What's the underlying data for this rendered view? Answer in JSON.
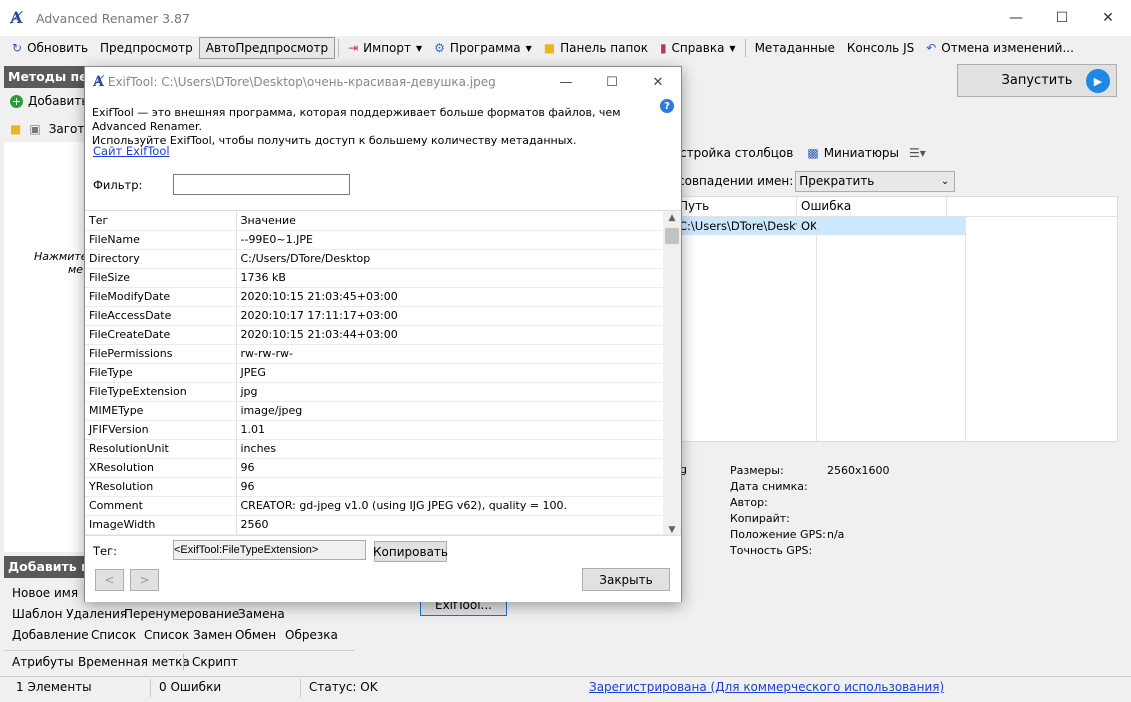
{
  "app": {
    "title": "Advanced Renamer 3.87",
    "icon": "app-logo-icon"
  },
  "window_controls": {
    "minimize": "—",
    "maximize": "☐",
    "close": "✕"
  },
  "toolbar": {
    "refresh": "Обновить",
    "preview": "Предпросмотр",
    "autopreview": "АвтоПредпросмотр",
    "import": "Импорт",
    "program": "Программа",
    "folder_panel": "Панель папок",
    "help": "Справка",
    "metadata": "Метаданные",
    "js_console": "Консоль JS",
    "undo": "Отмена изменений..."
  },
  "run_button": "Запустить",
  "left_panel": {
    "header": "Методы пе",
    "add": "Добавить",
    "templates": "Загот",
    "hint_line1": "Нажмите к",
    "hint_line2": "мет"
  },
  "right_panel": {
    "column_setup": "стройка столбцов",
    "thumbnails": "Миниатюры",
    "name_conflict_label": "совпадении имен:",
    "name_conflict_value": "Прекратить",
    "columns": [
      "Путь",
      "Ошибка"
    ],
    "rows": [
      [
        "C:\\Users\\DTore\\Desktop\\",
        "OK"
      ]
    ],
    "partial_text": "g"
  },
  "info_panel": {
    "labels": [
      "Размеры:",
      "Дата снимка:",
      "Автор:",
      "Копирайт:",
      "Положение GPS:",
      "Точность GPS:"
    ],
    "values": [
      "2560x1600",
      "",
      "",
      "",
      "n/a",
      ""
    ],
    "exiftool_button": "ExifTool..."
  },
  "add_methods": {
    "header": "Добавить м",
    "row1": [
      "Новое имя"
    ],
    "row2": [
      "Шаблон Удаления",
      "Перенумерование",
      "Замена"
    ],
    "row3": [
      "Добавление",
      "Список",
      "Список Замен",
      "Обмен",
      "Обрезка"
    ],
    "row4": [
      "Атрибуты",
      "Временная метка",
      "Скрипт"
    ]
  },
  "status_bar": {
    "items": "1 Элементы",
    "errors": "0 Ошибки",
    "status": "Статус: OK",
    "registered": "Зарегистрирована  (Для коммерческого использования)"
  },
  "dialog": {
    "title": "ExifTool: C:\\Users\\DTore\\Desktop\\очень-красивая-девушка.jpeg",
    "description_line1": "ExifTool — это внешняя программа, которая поддерживает больше форматов файлов, чем Advanced Renamer.",
    "description_line2": "Используйте ExifTool, чтобы получить доступ к большему количеству метаданных.",
    "site_link": "Сайт ExifTool",
    "filter_label": "Фильтр:",
    "filter_value": "",
    "table_headers": [
      "Тег",
      "Значение"
    ],
    "rows": [
      [
        "FileName",
        "--99E0~1.JPE"
      ],
      [
        "Directory",
        "C:/Users/DTore/Desktop"
      ],
      [
        "FileSize",
        "1736 kB"
      ],
      [
        "FileModifyDate",
        "2020:10:15 21:03:45+03:00"
      ],
      [
        "FileAccessDate",
        "2020:10:17 17:11:17+03:00"
      ],
      [
        "FileCreateDate",
        "2020:10:15 21:03:44+03:00"
      ],
      [
        "FilePermissions",
        "rw-rw-rw-"
      ],
      [
        "FileType",
        "JPEG"
      ],
      [
        "FileTypeExtension",
        "jpg"
      ],
      [
        "MIMEType",
        "image/jpeg"
      ],
      [
        "JFIFVersion",
        "1.01"
      ],
      [
        "ResolutionUnit",
        "inches"
      ],
      [
        "XResolution",
        "96"
      ],
      [
        "YResolution",
        "96"
      ],
      [
        "Comment",
        "CREATOR: gd-jpeg v1.0 (using IJG JPEG v62), quality = 100."
      ],
      [
        "ImageWidth",
        "2560"
      ]
    ],
    "tag_label": "Тег:",
    "tag_value": "<ExifTool:FileTypeExtension>",
    "copy_button": "Копировать",
    "prev_button": "<",
    "next_button": ">",
    "close_button": "Закрыть",
    "help_icon": "?"
  }
}
